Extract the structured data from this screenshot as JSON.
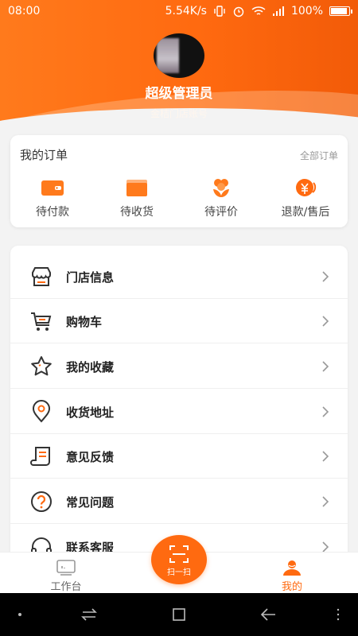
{
  "status": {
    "time": "08:00",
    "speed": "5.54K/s",
    "battery": "100%"
  },
  "profile": {
    "name": "超级管理员",
    "account": "金桔门店账号"
  },
  "orders": {
    "title": "我的订单",
    "all_link": "全部订单",
    "items": [
      {
        "label": "待付款",
        "icon": "wallet-icon"
      },
      {
        "label": "待收货",
        "icon": "package-icon"
      },
      {
        "label": "待评价",
        "icon": "flower-icon"
      },
      {
        "label": "退款/售后",
        "icon": "yen-refund-icon"
      }
    ]
  },
  "menu": {
    "items": [
      {
        "label": "门店信息",
        "icon": "store-icon"
      },
      {
        "label": "购物车",
        "icon": "cart-icon"
      },
      {
        "label": "我的收藏",
        "icon": "star-icon"
      },
      {
        "label": "收货地址",
        "icon": "location-pin-icon"
      },
      {
        "label": "意见反馈",
        "icon": "feedback-scroll-icon"
      },
      {
        "label": "常见问题",
        "icon": "question-icon"
      },
      {
        "label": "联系客服",
        "icon": "headset-icon"
      }
    ]
  },
  "tabbar": {
    "left": {
      "label": "工作台",
      "icon": "workbench-icon"
    },
    "center": {
      "label": "扫一扫",
      "icon": "scan-icon"
    },
    "right": {
      "label": "我的",
      "icon": "person-icon"
    }
  },
  "colors": {
    "accent": "#ff6a10",
    "active_tab": "#ff6a10",
    "inactive_tab": "#666666"
  }
}
